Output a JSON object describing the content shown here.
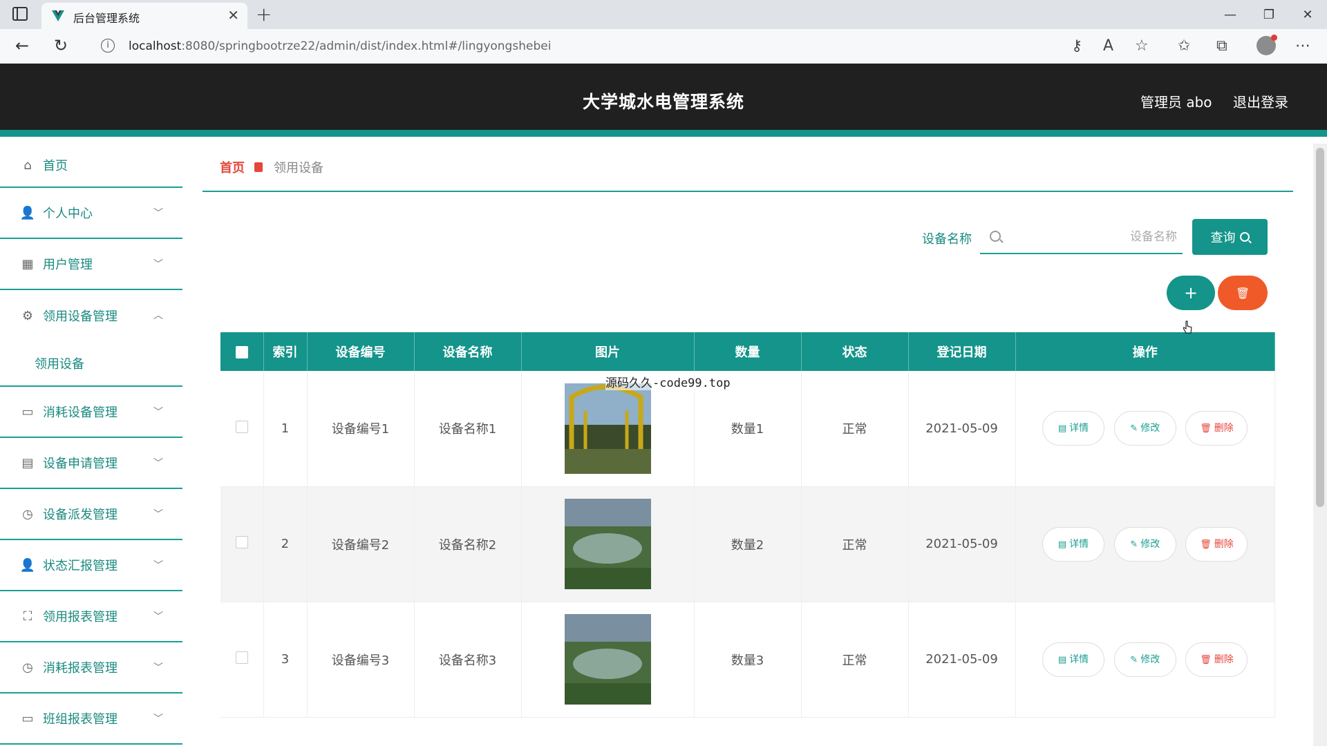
{
  "browser": {
    "tab_title": "后台管理系统",
    "url_host": "localhost",
    "url_rest": ":8080/springbootrze22/admin/dist/index.html#/lingyongshebei"
  },
  "header": {
    "title": "大学城水电管理系统",
    "admin": "管理员 abo",
    "logout": "退出登录"
  },
  "sidebar": {
    "items": [
      {
        "label": "首页",
        "icon": "home-icon"
      },
      {
        "label": "个人中心",
        "icon": "user-icon"
      },
      {
        "label": "用户管理",
        "icon": "grid-icon"
      },
      {
        "label": "领用设备管理",
        "icon": "settings-icon"
      },
      {
        "label": "消耗设备管理",
        "icon": "monitor-icon"
      },
      {
        "label": "设备申请管理",
        "icon": "document-icon"
      },
      {
        "label": "设备派发管理",
        "icon": "dashboard-icon"
      },
      {
        "label": "状态汇报管理",
        "icon": "user-icon"
      },
      {
        "label": "领用报表管理",
        "icon": "fullscreen-icon"
      },
      {
        "label": "消耗报表管理",
        "icon": "dashboard-icon"
      },
      {
        "label": "班组报表管理",
        "icon": "message-icon"
      }
    ],
    "sub_item": "领用设备"
  },
  "breadcrumb": {
    "home": "首页",
    "current": "领用设备"
  },
  "search": {
    "label": "设备名称",
    "placeholder": "设备名称",
    "button": "查询"
  },
  "toolbar": {
    "add": "+",
    "delete": "🗑"
  },
  "table": {
    "headers": [
      "索引",
      "设备编号",
      "设备名称",
      "图片",
      "数量",
      "状态",
      "登记日期",
      "操作"
    ],
    "rows": [
      {
        "index": "1",
        "code": "设备编号1",
        "name": "设备名称1",
        "qty": "数量1",
        "status": "正常",
        "date": "2021-05-09"
      },
      {
        "index": "2",
        "code": "设备编号2",
        "name": "设备名称2",
        "qty": "数量2",
        "status": "正常",
        "date": "2021-05-09"
      },
      {
        "index": "3",
        "code": "设备编号3",
        "name": "设备名称3",
        "qty": "数量3",
        "status": "正常",
        "date": "2021-05-09"
      }
    ],
    "actions": {
      "detail": "详情",
      "edit": "修改",
      "remove": "删除"
    }
  },
  "overlay_text": "源码久久-code99.top",
  "colors": {
    "primary": "#14948a",
    "danger": "#f05a28",
    "header_bg": "#202020"
  }
}
